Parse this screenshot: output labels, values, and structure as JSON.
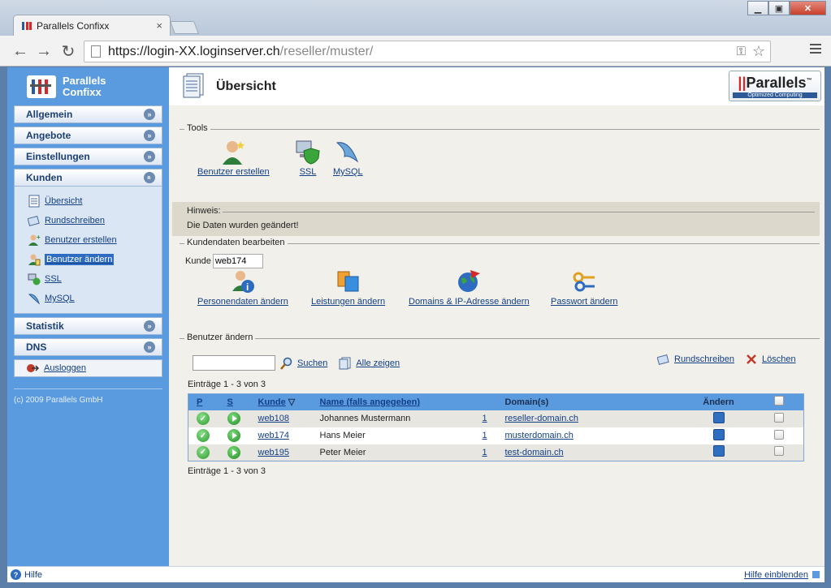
{
  "browser": {
    "tab_title": "Parallels Confixx",
    "tab_close": "×",
    "url_main": "https://login-XX.loginserver.ch",
    "url_rest": "/reseller/muster/",
    "win_minimize": "▁",
    "win_maximize": "▣",
    "win_close": "✕",
    "back": "←",
    "forward": "→",
    "reload": "↻",
    "key_icon": "⚿",
    "star_icon": "☆"
  },
  "sidebar": {
    "logo_line1": "Parallels",
    "logo_line2": "Confixx",
    "sections": [
      {
        "label": "Allgemein",
        "chevron": "»"
      },
      {
        "label": "Angebote",
        "chevron": "»"
      },
      {
        "label": "Einstellungen",
        "chevron": "»"
      },
      {
        "label": "Kunden",
        "chevron": "«"
      }
    ],
    "kunden_items": [
      {
        "label": "Übersicht",
        "icon": "overview-icon"
      },
      {
        "label": "Rundschreiben",
        "icon": "newsletter-icon"
      },
      {
        "label": "Benutzer erstellen",
        "icon": "user-create-icon"
      },
      {
        "label": "Benutzer ändern",
        "icon": "user-edit-icon"
      },
      {
        "label": "SSL",
        "icon": "ssl-icon"
      },
      {
        "label": "MySQL",
        "icon": "mysql-icon"
      }
    ],
    "sections_after": [
      {
        "label": "Statistik",
        "chevron": "»"
      },
      {
        "label": "DNS",
        "chevron": "»"
      }
    ],
    "logout_label": "Ausloggen",
    "copyright": "(c) 2009 Parallels GmbH"
  },
  "header": {
    "title": "Übersicht",
    "brand_name": "Parallels",
    "brand_tm": "™",
    "brand_sub": "Optimized Computing"
  },
  "tools": {
    "legend": "Tools",
    "items": [
      {
        "label": "Benutzer erstellen",
        "icon": "user-create-icon"
      },
      {
        "label": "SSL",
        "icon": "ssl-icon"
      },
      {
        "label": "MySQL",
        "icon": "mysql-icon"
      }
    ]
  },
  "notice": {
    "title": "Hinweis:",
    "text": "Die Daten wurden geändert!"
  },
  "kundendaten": {
    "legend": "Kundendaten bearbeiten",
    "kunde_label": "Kunde",
    "kunde_value": "web174",
    "actions": [
      {
        "label": "Personendaten ändern",
        "icon": "person-info-icon"
      },
      {
        "label": "Leistungen ändern",
        "icon": "services-icon"
      },
      {
        "label": "Domains & IP-Adresse ändern",
        "icon": "domains-icon"
      },
      {
        "label": "Passwort ändern",
        "icon": "keys-icon"
      }
    ]
  },
  "benutzer": {
    "legend": "Benutzer ändern",
    "search_value": "",
    "search_label": "Suchen",
    "show_all_label": "Alle zeigen",
    "newsletter_label": "Rundschreiben",
    "delete_label": "Löschen",
    "count_text": "Einträge 1 - 3 von 3",
    "columns": {
      "p": "P",
      "s": "S",
      "kunde": "Kunde",
      "sort_icon": "▽",
      "name": "Name (falls angegeben)",
      "domains": "Domain(s)",
      "aendern": "Ändern"
    },
    "rows": [
      {
        "kunde": "web108",
        "name": "Johannes Mustermann",
        "count": "1",
        "domain": "reseller-domain.ch"
      },
      {
        "kunde": "web174",
        "name": "Hans Meier",
        "count": "1",
        "domain": "musterdomain.ch"
      },
      {
        "kunde": "web195",
        "name": "Peter Meier",
        "count": "1",
        "domain": "test-domain.ch"
      }
    ]
  },
  "footer": {
    "help": "Hilfe",
    "help_show": "Hilfe einblenden"
  },
  "colors": {
    "sidebar": "#5a9be0",
    "content_bg": "#f2f0ea",
    "link": "#123f86",
    "brand_red": "#d4282a"
  }
}
